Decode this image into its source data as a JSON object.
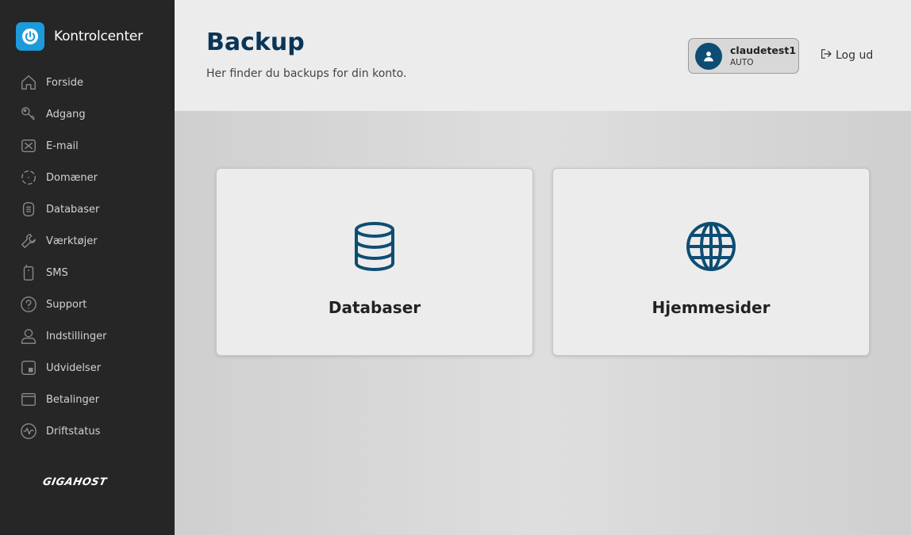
{
  "app": {
    "title": "Kontrolcenter",
    "brand_color": "#1d9ad9"
  },
  "sidebar": {
    "items": [
      {
        "label": "Forside",
        "icon": "home-icon"
      },
      {
        "label": "Adgang",
        "icon": "key-icon"
      },
      {
        "label": "E-mail",
        "icon": "mail-icon"
      },
      {
        "label": "Domæner",
        "icon": "domain-icon"
      },
      {
        "label": "Databaser",
        "icon": "database-icon"
      },
      {
        "label": "Værktøjer",
        "icon": "wrench-icon"
      },
      {
        "label": "SMS",
        "icon": "phone-icon"
      },
      {
        "label": "Support",
        "icon": "help-icon"
      },
      {
        "label": "Indstillinger",
        "icon": "user-icon"
      },
      {
        "label": "Udvidelser",
        "icon": "extension-icon"
      },
      {
        "label": "Betalinger",
        "icon": "payment-icon"
      },
      {
        "label": "Driftstatus",
        "icon": "pulse-icon"
      }
    ],
    "footer_logo": "GIGAHOST"
  },
  "header": {
    "title": "Backup",
    "subtitle": "Her finder du backups for din konto.",
    "user": {
      "name": "claudetest1",
      "role": "AUTO"
    },
    "logout_label": "Log ud"
  },
  "cards": [
    {
      "label": "Databaser",
      "icon": "database-icon"
    },
    {
      "label": "Hjemmesider",
      "icon": "globe-icon"
    }
  ],
  "colors": {
    "accent": "#0e4d73",
    "title": "#0b3556",
    "sidebar_bg": "#262626"
  }
}
